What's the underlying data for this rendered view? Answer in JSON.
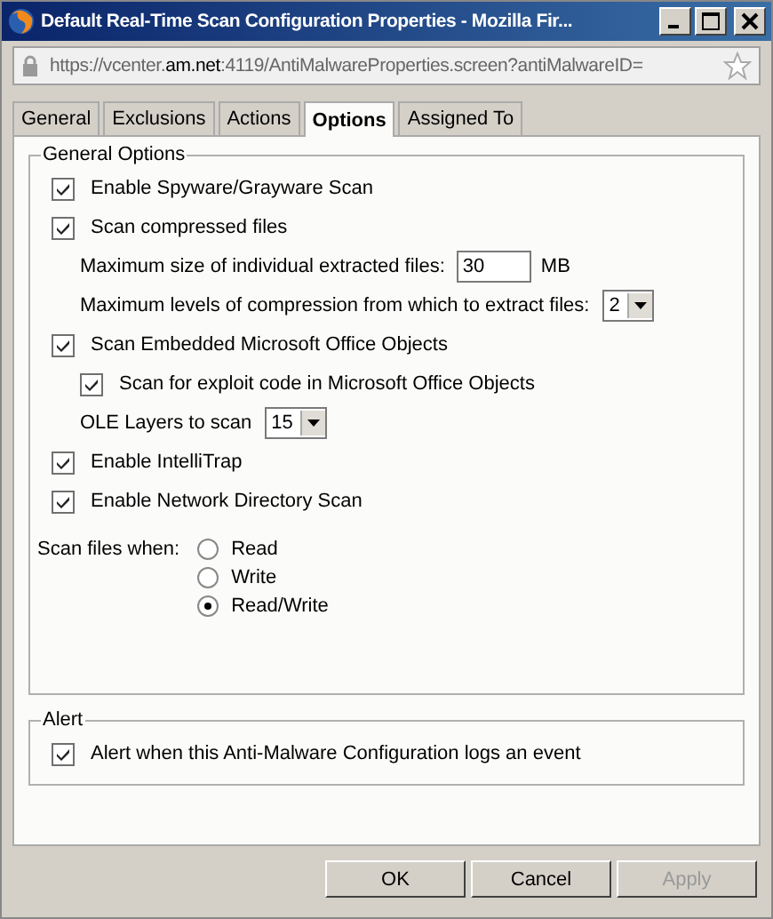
{
  "window": {
    "title": "Default Real-Time Scan Configuration Properties - Mozilla Fir..."
  },
  "address_bar": {
    "url_prefix": "https://vcenter.",
    "url_domain": "am.net",
    "url_rest": ":4119/AntiMalwareProperties.screen?antiMalwareID="
  },
  "tabs": [
    {
      "label": "General",
      "selected": false
    },
    {
      "label": "Exclusions",
      "selected": false
    },
    {
      "label": "Actions",
      "selected": false
    },
    {
      "label": "Options",
      "selected": true
    },
    {
      "label": "Assigned To",
      "selected": false
    }
  ],
  "general_options": {
    "legend": "General Options",
    "items": [
      {
        "kind": "checkbox",
        "label": "Enable Spyware/Grayware Scan",
        "checked": true
      },
      {
        "kind": "checkbox",
        "label": "Scan compressed files",
        "checked": true,
        "children": [
          {
            "kind": "field",
            "label": "Maximum size of individual extracted files:",
            "value": "30",
            "unit": "MB"
          },
          {
            "kind": "select",
            "label": "Maximum levels of compression from which to extract files:",
            "value": "2"
          }
        ]
      },
      {
        "kind": "checkbox",
        "label": "Scan Embedded Microsoft Office Objects",
        "checked": true,
        "children": [
          {
            "kind": "checkbox",
            "label": "Scan for exploit code in Microsoft Office Objects",
            "checked": true
          },
          {
            "kind": "select",
            "label": "OLE Layers to scan",
            "value": "15"
          }
        ]
      },
      {
        "kind": "checkbox",
        "label": "Enable IntelliTrap",
        "checked": true
      },
      {
        "kind": "checkbox",
        "label": "Enable Network Directory Scan",
        "checked": true
      }
    ],
    "scan_files_when": {
      "label": "Scan files when:",
      "options": [
        {
          "label": "Read",
          "selected": false
        },
        {
          "label": "Write",
          "selected": false
        },
        {
          "label": "Read/Write",
          "selected": true
        }
      ]
    }
  },
  "alert": {
    "legend": "Alert",
    "items": [
      {
        "kind": "checkbox",
        "label": "Alert when this Anti-Malware Configuration logs an event",
        "checked": true
      }
    ]
  },
  "buttons": [
    {
      "label": "OK",
      "disabled": false
    },
    {
      "label": "Cancel",
      "disabled": false
    },
    {
      "label": "Apply",
      "disabled": true
    }
  ]
}
